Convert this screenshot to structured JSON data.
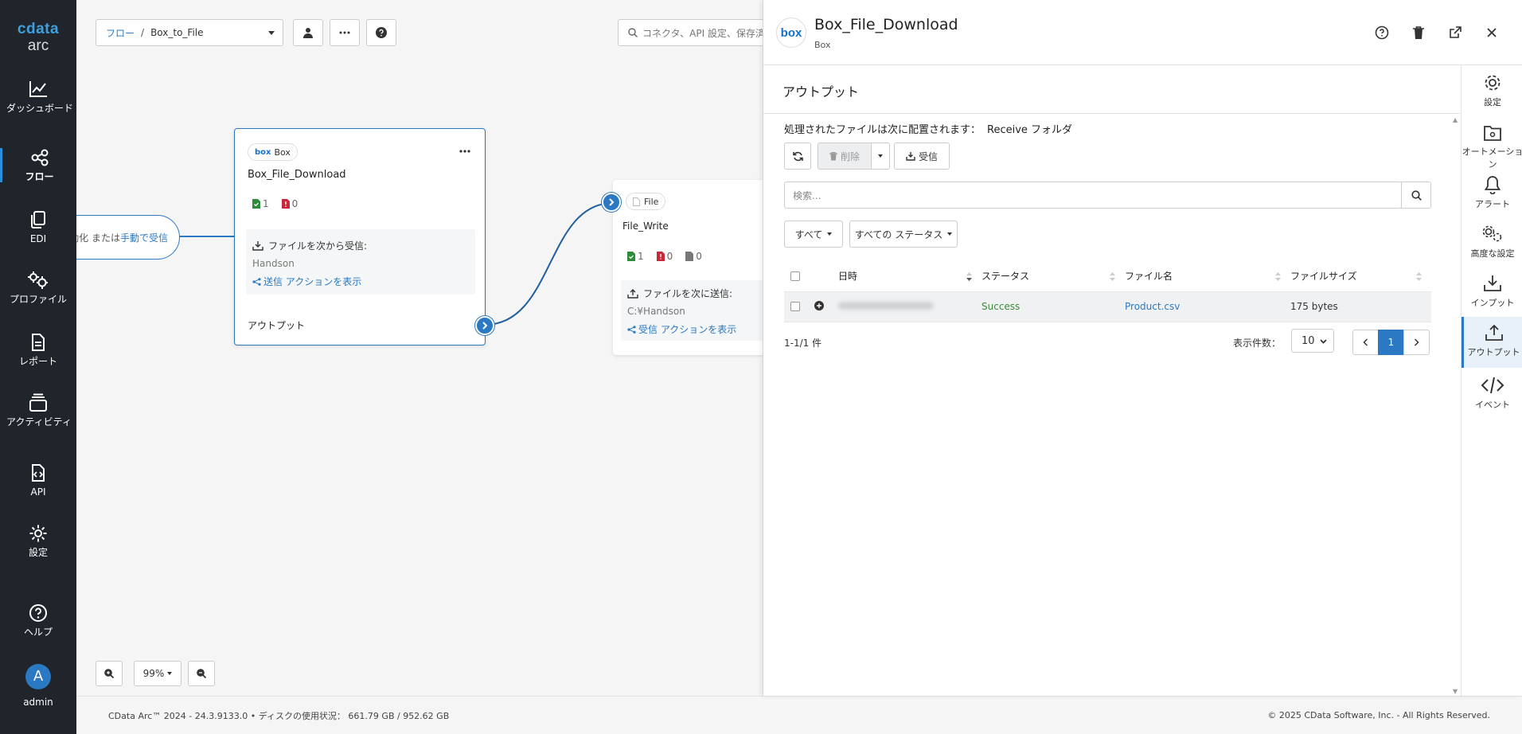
{
  "sidebar": {
    "logo_top": "cdata",
    "logo_bottom": "arc",
    "items": [
      {
        "label": "ダッシュボード"
      },
      {
        "label": "フロー"
      },
      {
        "label": "EDI"
      },
      {
        "label": "プロファイル"
      },
      {
        "label": "レポート"
      },
      {
        "label": "アクティビティ"
      },
      {
        "label": "API"
      },
      {
        "label": "設定"
      },
      {
        "label": "ヘルプ"
      }
    ],
    "user": {
      "initial": "A",
      "name": "admin"
    },
    "accent": "#2a8fd9"
  },
  "toolbar": {
    "breadcrumb_root": "フロー",
    "breadcrumb_sep": "/",
    "breadcrumb_current": "Box_to_File",
    "search_placeholder": "コネクタ、API 設定、保存済み"
  },
  "canvas": {
    "trigger": {
      "text_plain": "動化 または ",
      "text_link": "手動で受信"
    },
    "node_box": {
      "chip_logo": "box",
      "chip_label": "Box",
      "title": "Box_File_Download",
      "success_count": "1",
      "error_count": "0",
      "info_label": "ファイルを次から受信:",
      "info_value": "Handson",
      "info_link": "送信 アクションを表示",
      "output_label": "アウトプット"
    },
    "node_file": {
      "chip_label": "File",
      "title": "File_Write",
      "success_count": "1",
      "error_count": "0",
      "pending_count": "0",
      "info_label": "ファイルを次に送信:",
      "info_value": "C:¥Handson",
      "info_link": "受信 アクションを表示"
    },
    "zoom_level": "99%"
  },
  "footer": {
    "left": "CData Arc™ 2024 - 24.3.9133.0  •  ディスクの使用状況： 661.79 GB / 952.62 GB",
    "right": "© 2025 CData Software, Inc. - All Rights Reserved."
  },
  "panel": {
    "logo": "box",
    "title": "Box_File_Download",
    "subtitle": "Box",
    "section_title": "アウトプット",
    "location_label": "処理されたファイルは次に配置されます：",
    "location_value": "Receive フォルダ",
    "delete_label": "削除",
    "receive_label": "受信",
    "search_placeholder": "検索...",
    "filter_all": "すべて",
    "filter_status": "すべての ステータス",
    "columns": [
      "日時",
      "ステータス",
      "ファイル名",
      "ファイルサイズ"
    ],
    "rows": [
      {
        "status": "Success",
        "filename": "Product.csv",
        "size": "175 bytes"
      }
    ],
    "pagination_info": "1-1/1 件",
    "per_page_label": "表示件数：",
    "per_page_value": "10",
    "current_page": "1",
    "status_color": "#3a8a3a",
    "rail": [
      {
        "label": "設定"
      },
      {
        "label": "オートメーション"
      },
      {
        "label": "アラート"
      },
      {
        "label": "高度な設定"
      },
      {
        "label": "インプット"
      },
      {
        "label": "アウトプット"
      },
      {
        "label": "イベント"
      }
    ]
  }
}
